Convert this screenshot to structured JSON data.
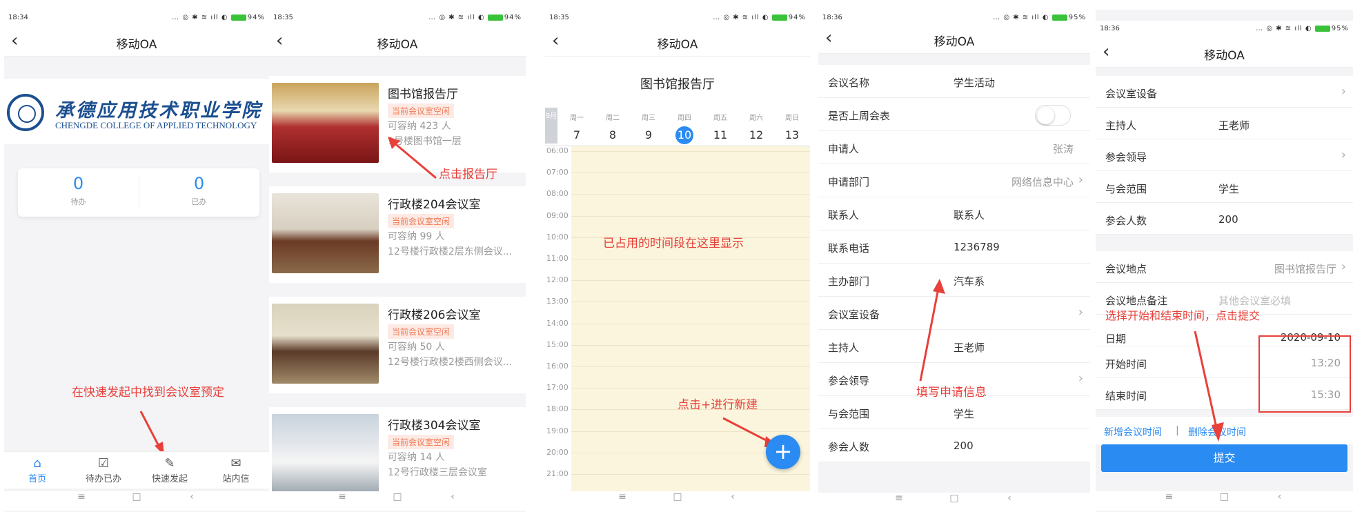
{
  "screens": {
    "home": {
      "status": {
        "time": "18:34",
        "icons": "… ◎ ✱ ≋ ıll ◐",
        "battery": "94%"
      },
      "title": "移动OA",
      "logo": {
        "cn": "承德应用技术职业学院",
        "en": "CHENGDE COLLEGE OF APPLIED TECHNOLOGY"
      },
      "stats": [
        {
          "value": "0",
          "label": "待办"
        },
        {
          "value": "0",
          "label": "已办"
        }
      ],
      "tabs": [
        {
          "icon": "⌂",
          "label": "首页"
        },
        {
          "icon": "☑",
          "label": "待办已办"
        },
        {
          "icon": "✎",
          "label": "快速发起"
        },
        {
          "icon": "✉",
          "label": "站内信"
        }
      ],
      "annotation": "在快速发起中找到会议室预定"
    },
    "rooms": {
      "status": {
        "time": "18:35",
        "icons": "… ◎ ✱ ≋ ıll ◐",
        "battery": "94%"
      },
      "title": "移动OA",
      "items": [
        {
          "name": "图书馆报告厅",
          "tag": "当前会议室空闲",
          "capacity": "可容纳 423 人",
          "location": "1号楼图书馆一层"
        },
        {
          "name": "行政楼204会议室",
          "tag": "当前会议室空闲",
          "capacity": "可容纳 99 人",
          "location": "12号楼行政楼2层东侧会议..."
        },
        {
          "name": "行政楼206会议室",
          "tag": "当前会议室空闲",
          "capacity": "可容纳 50 人",
          "location": "12号楼行政楼2楼西侧会议..."
        },
        {
          "name": "行政楼304会议室",
          "tag": "当前会议室空闲",
          "capacity": "可容纳 14 人",
          "location": "12号行政楼三层会议室"
        }
      ],
      "annotation": "点击报告厅"
    },
    "calendar": {
      "status": {
        "time": "18:35",
        "icons": "… ◎ ✱ ≋ ıll ◐",
        "battery": "94%"
      },
      "title": "移动OA",
      "room_title": "图书馆报告厅",
      "month": "9月",
      "days": [
        {
          "wd": "周一",
          "d": "7"
        },
        {
          "wd": "周二",
          "d": "8"
        },
        {
          "wd": "周三",
          "d": "9"
        },
        {
          "wd": "周四",
          "d": "10",
          "selected": true
        },
        {
          "wd": "周五",
          "d": "11"
        },
        {
          "wd": "周六",
          "d": "12"
        },
        {
          "wd": "周日",
          "d": "13"
        }
      ],
      "times": [
        "06:00",
        "07:00",
        "08:00",
        "09:00",
        "10:00",
        "11:00",
        "12:00",
        "13:00",
        "14:00",
        "15:00",
        "16:00",
        "17:00",
        "18:00",
        "19:00",
        "20:00",
        "21:00"
      ],
      "fab": "+",
      "annotation_occupied": "已占用的时间段在这里显示",
      "annotation_new": "点击+进行新建"
    },
    "form1": {
      "status": {
        "time": "18:36",
        "icons": "… ◎ ✱ ≋ ıll ◐",
        "battery": "95%"
      },
      "title": "移动OA",
      "fields": [
        {
          "key": "会议名称",
          "value": "学生活动"
        },
        {
          "key": "是否上周会表",
          "toggle": true
        },
        {
          "key": "申请人",
          "right": "张涛"
        },
        {
          "key": "申请部门",
          "right": "网络信息中心",
          "chev": true
        },
        {
          "key": "联系人",
          "value": "联系人"
        },
        {
          "key": "联系电话",
          "value": "1236789"
        },
        {
          "key": "主办部门",
          "value": "汽车系"
        },
        {
          "key": "会议室设备",
          "chev": true
        },
        {
          "key": "主持人",
          "value": "王老师"
        },
        {
          "key": "参会领导",
          "chev": true
        },
        {
          "key": "与会范围",
          "value": "学生"
        },
        {
          "key": "参会人数",
          "value": "200"
        }
      ],
      "annotation": "填写申请信息"
    },
    "form2": {
      "status": {
        "time": "18:36",
        "icons": "… ◎ ✱ ≋ ıll ◐",
        "battery": "95%"
      },
      "title": "移动OA",
      "fields_a": [
        {
          "key": "会议室设备",
          "chev": true
        },
        {
          "key": "主持人",
          "value": "王老师"
        },
        {
          "key": "参会领导",
          "chev": true
        },
        {
          "key": "与会范围",
          "value": "学生"
        },
        {
          "key": "参会人数",
          "value": "200"
        }
      ],
      "fields_b": [
        {
          "key": "会议地点",
          "right": "图书馆报告厅",
          "chev": true
        },
        {
          "key": "会议地点备注",
          "placeholder": "其他会议室必填"
        },
        {
          "key": "日期",
          "right": "2020-09-10"
        },
        {
          "key": "开始时间",
          "right": "13:20"
        },
        {
          "key": "结束时间",
          "right": "15:30"
        }
      ],
      "link_add": "新增会议时间",
      "link_sep": "|",
      "link_del": "删除会议时间",
      "submit": "提交",
      "annotation": "选择开始和结束时间，点击提交"
    }
  },
  "sysnav": [
    "≡",
    "□",
    "‹"
  ],
  "colors": {
    "accent": "#2a8bf2",
    "annotation": "#e8403a"
  }
}
